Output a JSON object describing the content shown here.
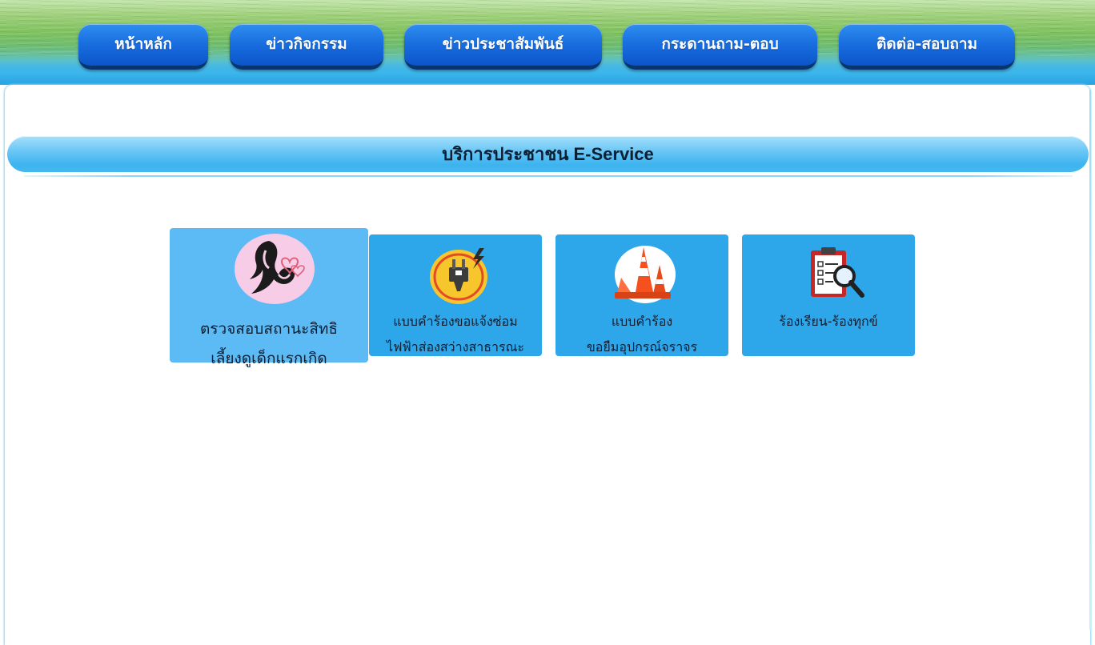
{
  "nav": {
    "items": [
      {
        "label": "หน้าหลัก"
      },
      {
        "label": "ข่าวกิจกรรม"
      },
      {
        "label": "ข่าวประชาสัมพันธ์"
      },
      {
        "label": "กระดานถาม-ตอบ"
      },
      {
        "label": "ติดต่อ-สอบถาม"
      }
    ]
  },
  "section": {
    "title": "บริการประชาชน E-Service"
  },
  "services": [
    {
      "icon": "mother-baby-icon",
      "line1": "ตรวจสอบสถานะสิทธิ",
      "line2": "เลี้ยงดูเด็กแรกเกิด"
    },
    {
      "icon": "electric-plug-icon",
      "line1": "แบบคำร้องขอแจ้งซ่อม",
      "line2": "ไฟฟ้าส่องสว่างสาธารณะ"
    },
    {
      "icon": "traffic-cone-icon",
      "line1": "แบบคำร้อง",
      "line2": "ขอยืมอุปกรณ์จราจร"
    },
    {
      "icon": "clipboard-search-icon",
      "line1": "ร้องเรียน-ร้องทุกข์",
      "line2": ""
    }
  ],
  "colors": {
    "nav_button": "#1a6fe0",
    "card": "#2da6ea",
    "card_featured": "#5cbaf5",
    "section_bar": "#6cc8f5"
  }
}
